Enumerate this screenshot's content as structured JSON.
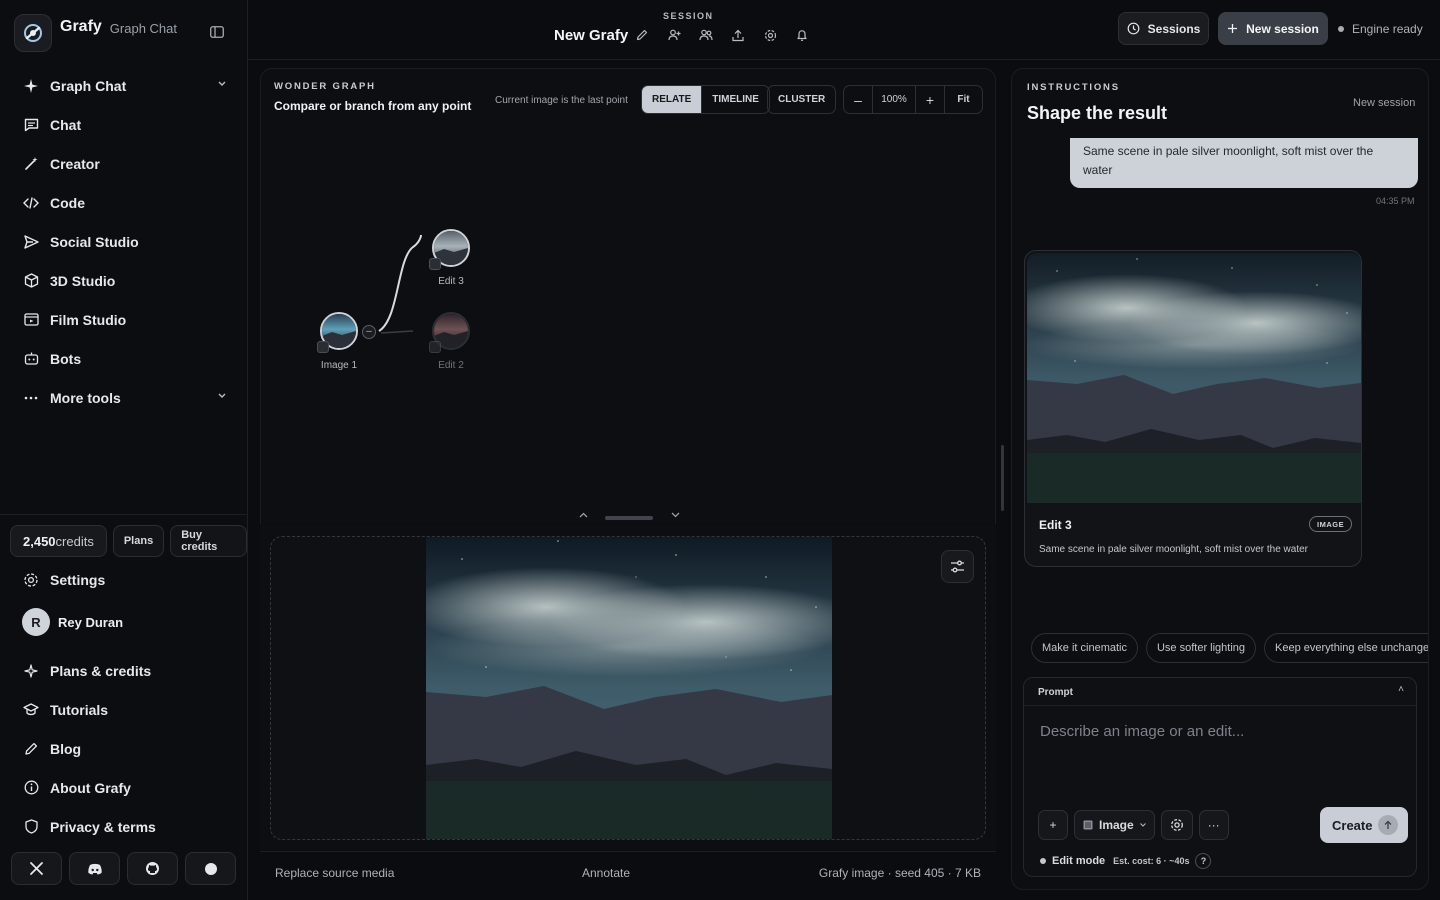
{
  "brand": {
    "name": "Grafy",
    "subtitle": "Graph Chat"
  },
  "nav": {
    "items": [
      {
        "label": "Graph Chat",
        "icon": "sparkle-icon",
        "chevron": true
      },
      {
        "label": "Chat",
        "icon": "chat-icon"
      },
      {
        "label": "Creator",
        "icon": "wand-icon"
      },
      {
        "label": "Code",
        "icon": "code-icon"
      },
      {
        "label": "Social Studio",
        "icon": "send-icon"
      },
      {
        "label": "3D Studio",
        "icon": "cube-icon"
      },
      {
        "label": "Film Studio",
        "icon": "film-icon"
      },
      {
        "label": "Bots",
        "icon": "bot-icon"
      },
      {
        "label": "More tools",
        "icon": "dots-icon",
        "chevron": true
      }
    ]
  },
  "credits": {
    "amount": "2,450",
    "unit": "credits",
    "plans_label": "Plans",
    "buy_label": "Buy credits"
  },
  "lower_nav": {
    "settings": "Settings",
    "user": {
      "initial": "R",
      "name": "Rey Duran"
    },
    "items": [
      "Plans & credits",
      "Tutorials",
      "Blog",
      "About Grafy",
      "Privacy & terms"
    ]
  },
  "topbar": {
    "session_label": "SESSION",
    "session_title": "New Grafy",
    "sessions_btn": "Sessions",
    "new_session_btn": "New session",
    "engine_status": "Engine ready"
  },
  "graph": {
    "label": "WONDER GRAPH",
    "subtitle": "Compare or branch from any point",
    "hint": "Current image is the last point",
    "modes": [
      "RELATE",
      "TIMELINE"
    ],
    "active_mode": "RELATE",
    "cluster": "CLUSTER",
    "zoom_minus": "–",
    "zoom_value": "100%",
    "zoom_plus": "+",
    "fit": "Fit",
    "nodes": [
      {
        "label": "Image 1"
      },
      {
        "label": "Edit 3"
      },
      {
        "label": "Edit 2"
      }
    ]
  },
  "preview_footer": {
    "replace": "Replace source media",
    "annotate": "Annotate",
    "meta": "Grafy image · seed 405 · 7 KB"
  },
  "instructions": {
    "label": "INSTRUCTIONS",
    "title": "Shape the result",
    "new_session": "New session",
    "user_message": "Same scene in pale silver moonlight, soft mist over the water",
    "message_time": "04:35 PM",
    "card": {
      "title": "Edit 3",
      "badge": "IMAGE",
      "description": "Same scene in pale silver moonlight, soft mist over the water"
    },
    "chips": [
      "Make it cinematic",
      "Use softer lighting",
      "Keep everything else unchanged"
    ],
    "prompt": {
      "header": "Prompt",
      "collapse": "˄",
      "placeholder": "Describe an image or an edit...",
      "add": "+",
      "mode": "Image",
      "more": "···",
      "create": "Create",
      "edit_mode": "Edit mode",
      "cost": "Est. cost: 6 · ~40s",
      "help": "?"
    }
  }
}
